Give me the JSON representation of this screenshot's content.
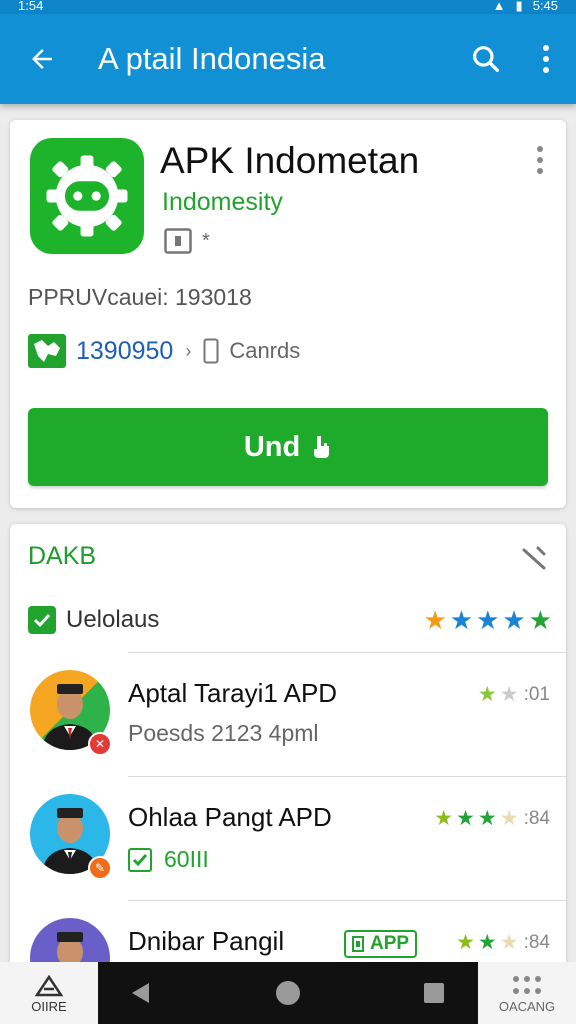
{
  "status_bar": {
    "time": "1:54",
    "right": "5:45"
  },
  "app_bar": {
    "title": "A ptail Indonesia"
  },
  "app": {
    "name": "APK Indometan",
    "developer": "Indomesity",
    "badge_text": "*",
    "version_label": "PPRUVcauei: 193018",
    "downloads": "1390950",
    "category": "Canrds",
    "install_label": "Und"
  },
  "section": {
    "title": "DAKB",
    "filter_label": "Uelolaus"
  },
  "items": [
    {
      "title": "Aptal Tarayi1 APD",
      "subtitle": "Poesds 2123 4pml",
      "rating": ":01"
    },
    {
      "title": "Ohlaa Pangt APD",
      "subtitle": "60III",
      "rating": ":84"
    },
    {
      "title": "Dnibar Pangil",
      "tag": "APP",
      "rating": ":84"
    }
  ],
  "bottom_nav": {
    "home_label": "OIIRE",
    "right_label": "OACANG"
  },
  "colors": {
    "primary": "#1190d6",
    "accent": "#1eaa2a",
    "star_orange": "#f59b18",
    "star_blue": "#1b83d6",
    "star_green": "#22a536"
  }
}
